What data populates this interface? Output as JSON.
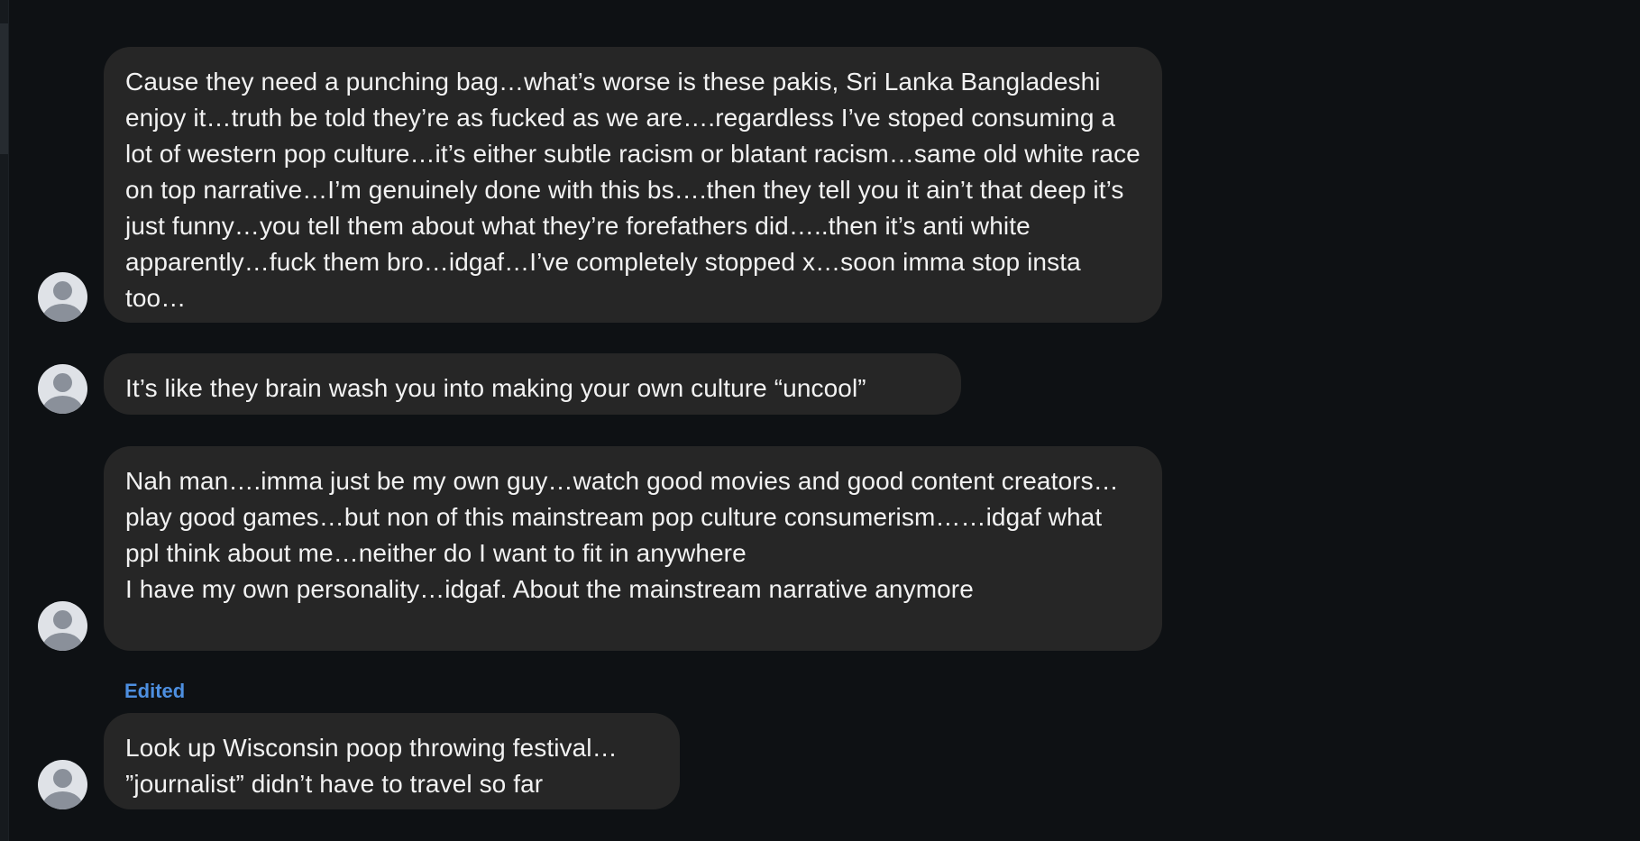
{
  "thread": {
    "messages": [
      {
        "text": "Cause they need a punching bag…what’s worse is these pakis, Sri Lanka Bangladeshi enjoy it…truth be told they’re as fucked as we are….regardless I’ve stoped consuming a lot of western pop culture…it’s either subtle racism or blatant racism…same old white race on top narrative…I’m genuinely done with this bs….then they tell you it ain’t that deep it’s just funny…you tell them about what they’re forefathers did…..then it’s anti white apparently…fuck them bro…idgaf…I’ve completely stopped x…soon imma stop insta too…"
      },
      {
        "text": "It’s like they brain wash you into making your own culture “uncool”"
      },
      {
        "text": "Nah man….imma just be my own guy…watch good movies and good content creators…play good games…but non of this mainstream pop culture consumerism……idgaf what ppl think about me…neither do I want to fit in anywhere\nI have my own personality…idgaf. About the mainstream narrative anymore"
      },
      {
        "edited_label": "Edited",
        "text": "Look up Wisconsin poop throwing festival…\n”journalist” didn’t have to travel so far"
      }
    ]
  },
  "icons": {
    "avatar": "default-user-avatar-icon"
  },
  "colors": {
    "background": "#0e1114",
    "bubble": "#262626",
    "text": "#f2f2f2",
    "edited": "#4d8fe0"
  }
}
